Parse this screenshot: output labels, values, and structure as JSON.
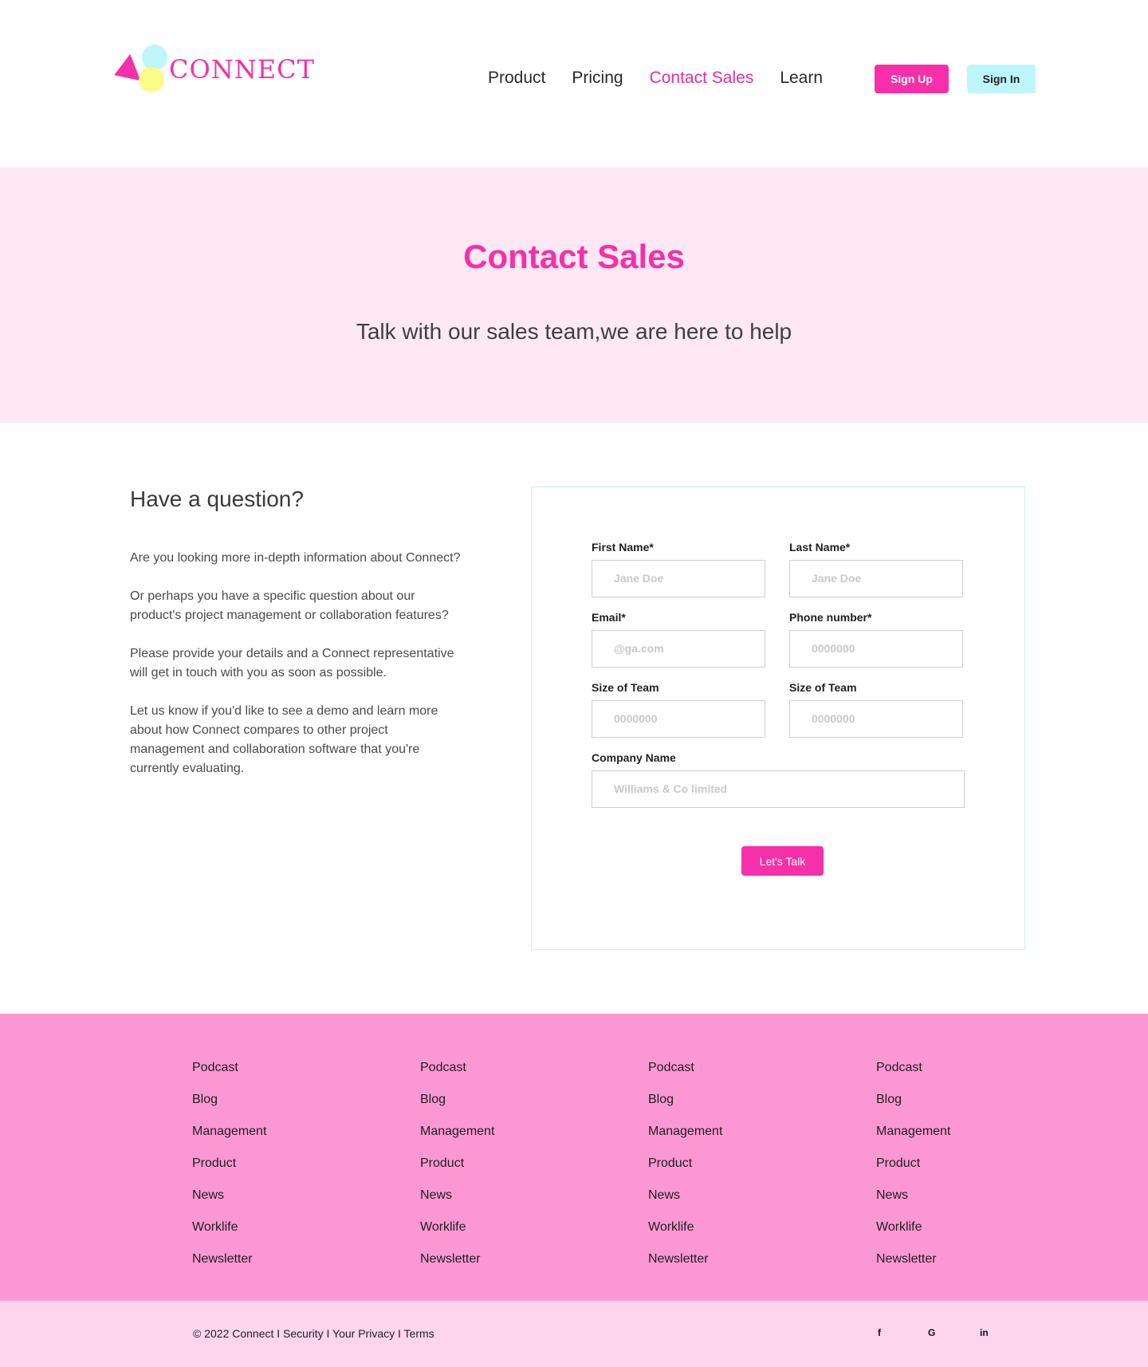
{
  "brand": {
    "name": "CONNECT",
    "primary": "#f72fa8",
    "accent": "#bdf6fb",
    "yellow": "#fbfb8a"
  },
  "nav": {
    "items": [
      "Product",
      "Pricing",
      "Contact Sales",
      "Learn"
    ],
    "active": "Contact Sales"
  },
  "header": {
    "signup": "Sign Up",
    "signin": "Sign In"
  },
  "hero": {
    "title": "Contact Sales",
    "subtitle": "Talk with our sales team,we are here to help"
  },
  "intro": {
    "heading": "Have a question?",
    "paragraphs": [
      "Are you looking more in-depth information about Connect?",
      "Or perhaps you have a specific question about our product's project management or collaboration features?",
      "Please provide your details and a Connect representative will get in touch with you as soon as possible.",
      "Let us know if you'd like to see a demo and learn more about how Connect compares to other project management and collaboration software that you're currently evaluating."
    ]
  },
  "form": {
    "first_name": {
      "label": "First Name*",
      "placeholder": "Jane Doe"
    },
    "last_name": {
      "label": "Last Name*",
      "placeholder": "Jane Doe"
    },
    "email": {
      "label": "Email*",
      "placeholder": "@ga.com"
    },
    "phone": {
      "label": "Phone number*",
      "placeholder": "0000000"
    },
    "team_size_1": {
      "label": "Size of Team",
      "placeholder": "0000000"
    },
    "team_size_2": {
      "label": "Size of Team",
      "placeholder": "0000000"
    },
    "company": {
      "label": "Company Name",
      "placeholder": "Williams & Co limited"
    },
    "submit": "Let's Talk"
  },
  "footer": {
    "columns": [
      [
        "Podcast",
        "Blog",
        "Management",
        "Product",
        "News",
        "Worklife",
        "Newsletter"
      ],
      [
        "Podcast",
        "Blog",
        "Management",
        "Product",
        "News",
        "Worklife",
        "Newsletter"
      ],
      [
        "Podcast",
        "Blog",
        "Management",
        "Product",
        "News",
        "Worklife",
        "Newsletter"
      ],
      [
        "Podcast",
        "Blog",
        "Management",
        "Product",
        "News",
        "Worklife",
        "Newsletter"
      ]
    ],
    "copyright": "© 2022 Connect I Security I Your Privacy I Terms",
    "social": [
      "f",
      "G",
      "in"
    ]
  }
}
